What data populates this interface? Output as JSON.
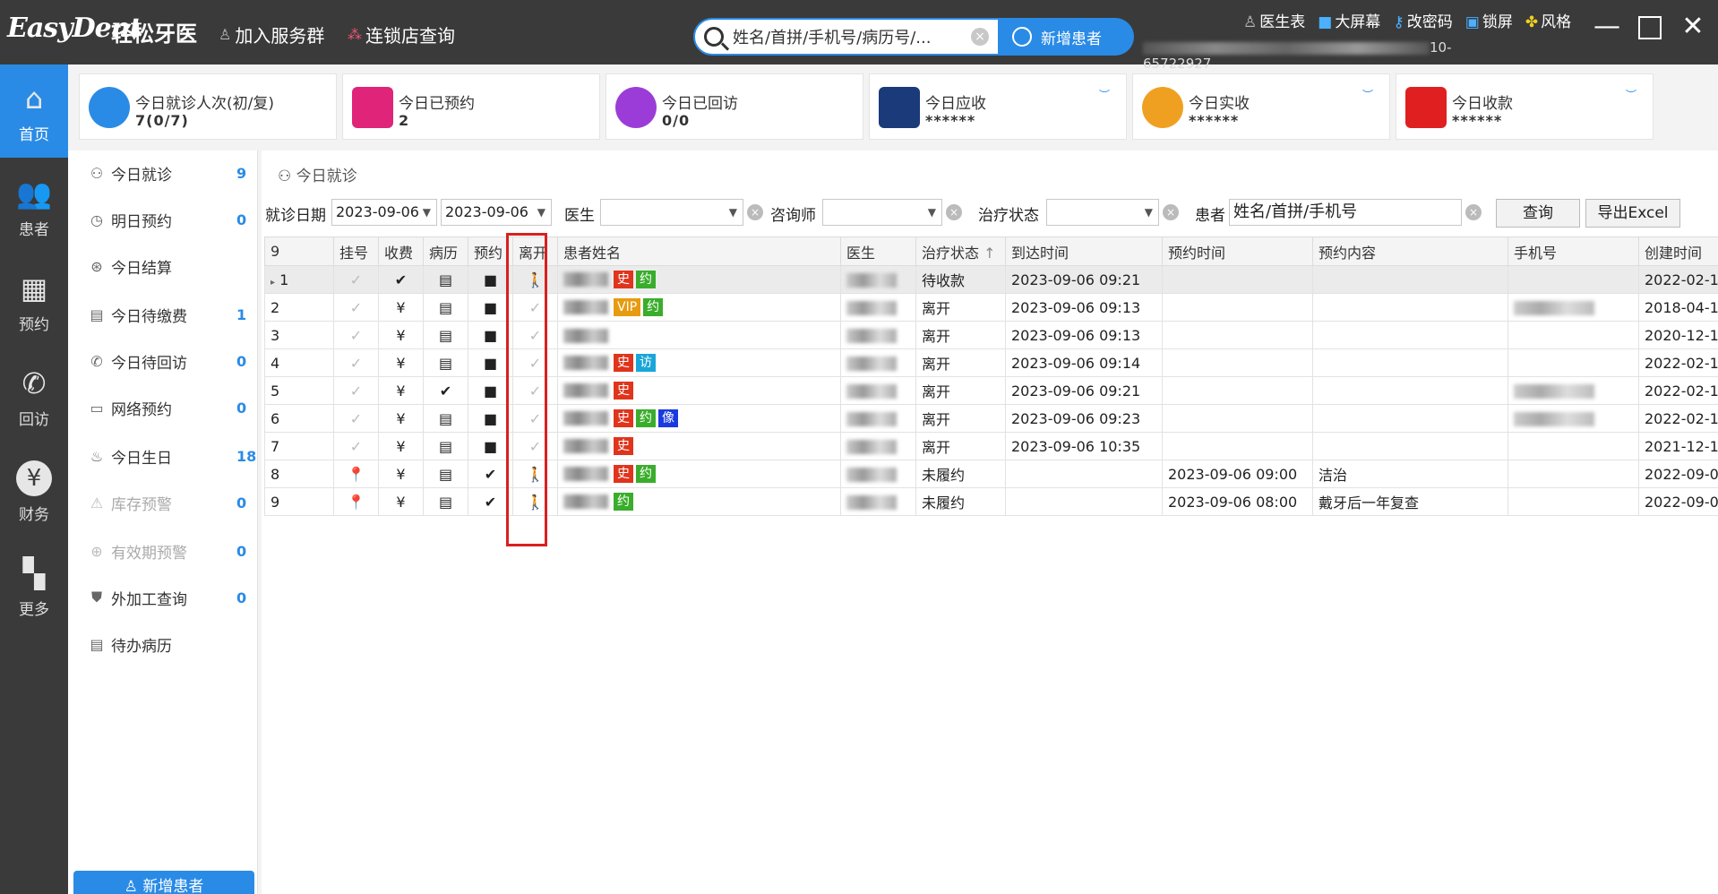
{
  "app": {
    "logo": "EasyDent",
    "name_cn": "轻松牙医",
    "join_group": "加入服务群",
    "chain_query": "连锁店查询"
  },
  "search": {
    "placeholder": "姓名/首拼/手机号/病历号/...",
    "add_patient": "新增患者"
  },
  "topbar": {
    "doctor_table": "医生表",
    "big_screen": "大屏幕",
    "change_password": "改密码",
    "lock_screen": "锁屏",
    "style": "风格",
    "phone_suffix": "10-65722927"
  },
  "nav": [
    {
      "label": "首页",
      "icon": "home-icon"
    },
    {
      "label": "患者",
      "icon": "patients-icon"
    },
    {
      "label": "预约",
      "icon": "calendar-icon"
    },
    {
      "label": "回访",
      "icon": "phone-icon"
    },
    {
      "label": "财务",
      "icon": "yen-icon"
    },
    {
      "label": "更多",
      "icon": "grid-icon"
    }
  ],
  "cards": [
    {
      "title": "今日就诊人次(初/复)",
      "value": "7(0/7)",
      "icon": "users-icon",
      "color": "#2a8be6"
    },
    {
      "title": "今日已预约",
      "value": "2",
      "icon": "calendar-icon",
      "color": "#e0247a"
    },
    {
      "title": "今日已回访",
      "value": "0/0",
      "icon": "chat-icon",
      "color": "#9b3cd8"
    },
    {
      "title": "今日应收",
      "value": "******",
      "icon": "exchange-icon",
      "color": "#1a3a7a"
    },
    {
      "title": "今日实收",
      "value": "******",
      "icon": "money-bag-icon",
      "color": "#f0a020"
    },
    {
      "title": "今日收款",
      "value": "******",
      "icon": "ticket-icon",
      "color": "#e02020"
    }
  ],
  "sidebar": [
    {
      "label": "今日就诊",
      "count": "9",
      "icon": "visit-icon"
    },
    {
      "label": "明日预约",
      "count": "0",
      "icon": "clock-icon"
    },
    {
      "label": "今日结算",
      "count": "",
      "icon": "settle-icon"
    },
    {
      "label": "今日待缴费",
      "count": "1",
      "icon": "bill-icon"
    },
    {
      "label": "今日待回访",
      "count": "0",
      "icon": "callback-icon"
    },
    {
      "label": "网络预约",
      "count": "0",
      "icon": "online-icon"
    },
    {
      "label": "今日生日",
      "count": "18",
      "icon": "cake-icon"
    },
    {
      "label": "库存预警",
      "count": "0",
      "icon": "stock-icon"
    },
    {
      "label": "有效期预警",
      "count": "0",
      "icon": "expiry-icon"
    },
    {
      "label": "外加工查询",
      "count": "0",
      "icon": "tooth-icon"
    },
    {
      "label": "待办病历",
      "count": "",
      "icon": "record-icon"
    }
  ],
  "sidebar_add_patient": "新增患者",
  "main": {
    "title": "今日就诊",
    "filters": {
      "visit_date_label": "就诊日期",
      "date_from": "2023-09-06",
      "date_to": "2023-09-06",
      "doctor_label": "医生",
      "consultant_label": "咨询师",
      "treatment_status_label": "治疗状态",
      "patient_label": "患者",
      "patient_placeholder": "姓名/首拼/手机号",
      "query_button": "查询",
      "export_button": "导出Excel"
    },
    "table": {
      "columns": [
        "9",
        "挂号",
        "收费",
        "病历",
        "预约",
        "离开",
        "患者姓名",
        "医生",
        "治疗状态",
        "到达时间",
        "预约时间",
        "预约内容",
        "手机号",
        "创建时间"
      ],
      "rows": [
        {
          "no": "1",
          "status": "待收款",
          "arrive": "2023-09-06 09:21",
          "appt_time": "",
          "appt_content": "",
          "created": "2022-02-1",
          "doctor_frag": "K...",
          "phone": "",
          "tags": [
            [
              "史",
              "t-red"
            ],
            [
              "约",
              "t-green"
            ]
          ]
        },
        {
          "no": "2",
          "status": "离开",
          "arrive": "2023-09-06 09:13",
          "appt_time": "",
          "appt_content": "",
          "created": "2018-04-1",
          "doctor_frag": "",
          "phone": "blur",
          "tags": [
            [
              "VIP",
              "t-orange"
            ],
            [
              "约",
              "t-green"
            ]
          ]
        },
        {
          "no": "3",
          "status": "离开",
          "arrive": "2023-09-06 09:13",
          "appt_time": "",
          "appt_content": "",
          "created": "2020-12-1",
          "doctor_frag": "",
          "phone": "",
          "tags": []
        },
        {
          "no": "4",
          "status": "离开",
          "arrive": "2023-09-06 09:14",
          "appt_time": "",
          "appt_content": "",
          "created": "2022-02-1",
          "doctor_frag": "",
          "phone": "",
          "tags": [
            [
              "史",
              "t-red"
            ],
            [
              "访",
              "t-cyan"
            ]
          ]
        },
        {
          "no": "5",
          "status": "离开",
          "arrive": "2023-09-06 09:21",
          "appt_time": "",
          "appt_content": "",
          "created": "2022-02-1",
          "doctor_frag": "K(",
          "phone": "blur",
          "tags": [
            [
              "史",
              "t-red"
            ]
          ]
        },
        {
          "no": "6",
          "status": "离开",
          "arrive": "2023-09-06 09:23",
          "appt_time": "",
          "appt_content": "",
          "created": "2022-02-1",
          "doctor_frag": "K",
          "phone": "blur",
          "tags": [
            [
              "史",
              "t-red"
            ],
            [
              "约",
              "t-green"
            ],
            [
              "像",
              "t-blue"
            ]
          ]
        },
        {
          "no": "7",
          "status": "离开",
          "arrive": "2023-09-06 10:35",
          "appt_time": "",
          "appt_content": "",
          "created": "2021-12-1",
          "doctor_frag": "",
          "phone": "",
          "tags": [
            [
              "史",
              "t-red"
            ]
          ]
        },
        {
          "no": "8",
          "status": "未履约",
          "arrive": "",
          "appt_time": "2023-09-06 09:00",
          "appt_content": "洁治",
          "created": "2022-09-0",
          "doctor_frag": "",
          "phone": "",
          "tags": [
            [
              "史",
              "t-red"
            ],
            [
              "约",
              "t-green"
            ]
          ]
        },
        {
          "no": "9",
          "status": "未履约",
          "arrive": "",
          "appt_time": "2023-09-06 08:00",
          "appt_content": "戴牙后一年复查",
          "created": "2022-09-0",
          "doctor_frag": "Q",
          "phone": "",
          "tags": [
            [
              "约",
              "t-green"
            ]
          ]
        }
      ]
    }
  }
}
